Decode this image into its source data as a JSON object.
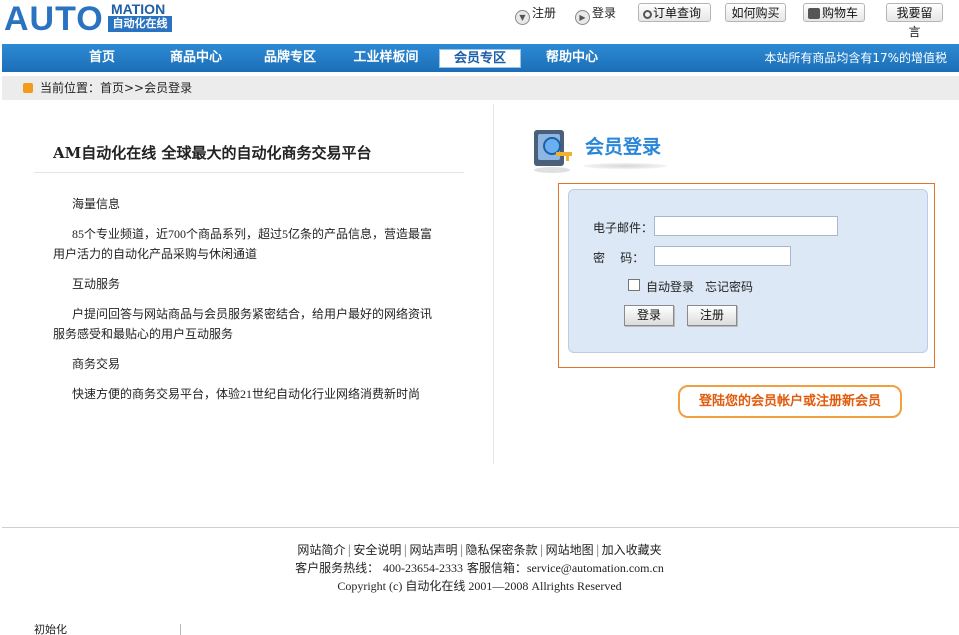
{
  "header": {
    "logo_main": "AUTO",
    "logo_sub": "MATION",
    "logo_cn": "自动化在线",
    "links": {
      "register": "注册",
      "login": "登录",
      "order_query": "订单查询",
      "how_to_buy": "如何购买",
      "cart": "购物车",
      "leave_message": "我要留言"
    }
  },
  "nav": {
    "items": [
      "首页",
      "商品中心",
      "品牌专区",
      "工业样板间",
      "会员专区",
      "帮助中心"
    ],
    "active": "会员专区",
    "note": "本站所有商品均含有17%的增值税"
  },
  "breadcrumb": {
    "text": "当前位置：首页>>会员登录"
  },
  "intro": {
    "headline": "AM自动化在线  全球最大的自动化商务交易平台",
    "sections": [
      {
        "title": "海量信息",
        "body": "85个专业频道，近700个商品系列，超过5亿条的产品信息，营造最富用户活力的自动化产品采购与休闲通道"
      },
      {
        "title": "互动服务",
        "body": "户提问回答与网站商品与会员服务紧密结合，给用户最好的网络资讯服务感受和最贴心的用户互动服务"
      },
      {
        "title": "商务交易",
        "body": "快速方便的商务交易平台，体验21世纪自动化行业网络消费新时尚"
      }
    ]
  },
  "login": {
    "title": "会员登录",
    "email_label": "电子邮件：",
    "email_value": "",
    "password_label": "密    码：",
    "password_value": "",
    "auto_login_label": "自动登录",
    "forgot_password": "忘记密码",
    "login_button": "登录",
    "register_button": "注册",
    "tip": "登陆您的会员帐户或注册新会员"
  },
  "footer": {
    "links": [
      "网站简介",
      "安全说明",
      "网站声明",
      "隐私保密条款",
      "网站地图",
      "加入收藏夹"
    ],
    "hotline_label": "客户服务热线：",
    "hotline": "400-23654-2333",
    "email_label": "客服信箱：",
    "email": "service@automation.com.cn",
    "copyright": "Copyright (c) 自动化在线  2001—2008 Allrights Reserved",
    "cut_text": "初始化"
  },
  "colors": {
    "nav_blue": "#1b6fb8",
    "accent_orange": "#e27427",
    "title_blue": "#2a86d8",
    "panel_bg": "#dde8f6"
  }
}
